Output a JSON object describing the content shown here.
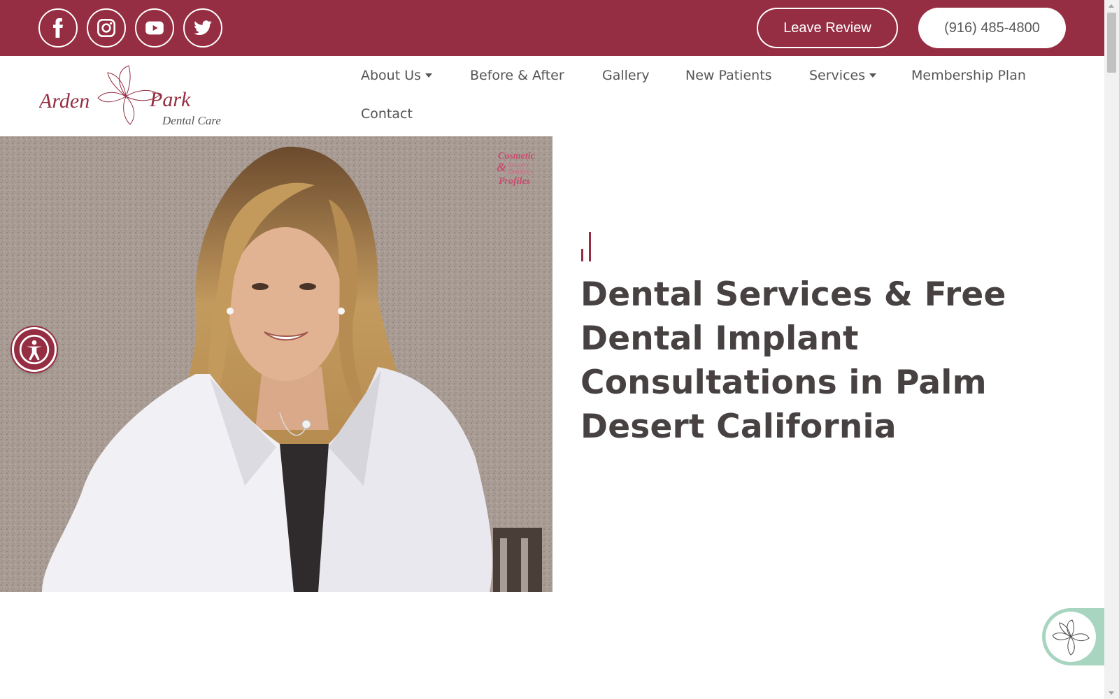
{
  "topbar": {
    "social": [
      {
        "name": "facebook-icon"
      },
      {
        "name": "instagram-icon"
      },
      {
        "name": "youtube-icon"
      },
      {
        "name": "twitter-icon"
      }
    ],
    "review_label": "Leave Review",
    "phone_label": "(916) 485-4800"
  },
  "logo": {
    "line1a": "Arden",
    "line1b": "Park",
    "line2": "Dental Care"
  },
  "nav": {
    "items": [
      {
        "label": "About Us",
        "dropdown": true
      },
      {
        "label": "Before & After",
        "dropdown": false
      },
      {
        "label": "Gallery",
        "dropdown": false
      },
      {
        "label": "New Patients",
        "dropdown": false
      },
      {
        "label": "Services",
        "dropdown": true
      },
      {
        "label": "Membership Plan",
        "dropdown": false
      },
      {
        "label": "Contact",
        "dropdown": false
      }
    ]
  },
  "hero": {
    "badge": {
      "line1": "Cosmetic",
      "line2": "&",
      "line3": "Surgery",
      "line4": "Dentistry",
      "line5": "Profiles"
    },
    "title": "Dental Services & Free Dental Implant Consultations in Palm Desert California"
  },
  "widgets": {
    "accessibility": "accessibility-icon",
    "chat": "chat-widget-icon"
  },
  "colors": {
    "brand": "#952e42",
    "heading": "#474142",
    "nav_text": "#555555"
  }
}
